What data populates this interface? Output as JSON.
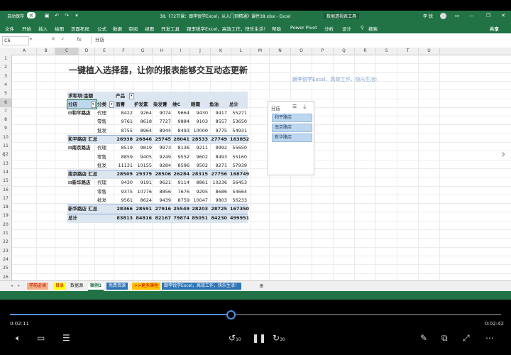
{
  "window": {
    "title": "38.《72节课：跟李锐学Excel，从入门到精通》课件38.xlsx - Excel",
    "context_tab": "数据透视表工具",
    "autosave_label": "自动保存",
    "autosave_state": "关",
    "user": "李 锐"
  },
  "ribbon": {
    "tabs": [
      "文件",
      "开始",
      "插入",
      "绘图",
      "页面布局",
      "公式",
      "数据",
      "审阅",
      "视图",
      "开发工具",
      "跟李锐学Excel，高效工作，快乐生活！",
      "帮助",
      "Power Pivot",
      "分析",
      "设计"
    ],
    "search_placeholder": "搜索",
    "share": "共享"
  },
  "formula_bar": {
    "name_box": "C6",
    "fx": "fx",
    "content": "分店"
  },
  "columns": [
    "A",
    "B",
    "C",
    "D",
    "E",
    "F",
    "G",
    "H",
    "I",
    "J",
    "K",
    "L",
    "M",
    "N",
    "O",
    "P",
    "Q",
    "R",
    "S",
    "T",
    "U"
  ],
  "rows": [
    "1",
    "2",
    "3",
    "4",
    "5",
    "6",
    "7",
    "8",
    "9",
    "10",
    "11",
    "12",
    "13",
    "14",
    "15",
    "16",
    "17",
    "18",
    "19",
    "20",
    "21",
    "22",
    "23",
    "24",
    "25",
    "26"
  ],
  "sheet": {
    "title": "一键植入选择器，让你的报表能够交互动态更新",
    "slogan": "跟李锐学Excel、高效工作、快乐生活!",
    "pivot": {
      "value_label": "求和项:金额",
      "col_field": "产品",
      "row_field1": "分店",
      "row_field2": "分类",
      "headers": [
        "面膏",
        "护发素",
        "染发膏",
        "维C",
        "眼霜",
        "鱼油",
        "总计"
      ],
      "rows": [
        {
          "store": "⊟和平路店",
          "cat": "代理",
          "vals": [
            "8422",
            "9264",
            "9074",
            "9664",
            "9430",
            "9417",
            "55271"
          ],
          "bold": false
        },
        {
          "store": "",
          "cat": "零售",
          "vals": [
            "9761",
            "8618",
            "7727",
            "9884",
            "9103",
            "8557",
            "53650"
          ],
          "bold": false
        },
        {
          "store": "",
          "cat": "批发",
          "vals": [
            "8755",
            "8964",
            "8944",
            "8493",
            "10000",
            "9775",
            "54931"
          ],
          "bold": false
        },
        {
          "store": "和平路店 汇总",
          "cat": "",
          "vals": [
            "26938",
            "26846",
            "25745",
            "28041",
            "28533",
            "27749",
            "163852"
          ],
          "bold": true
        },
        {
          "store": "⊟南京路店",
          "cat": "代理",
          "vals": [
            "8519",
            "9819",
            "9973",
            "8136",
            "9211",
            "9992",
            "55650"
          ],
          "bold": false
        },
        {
          "store": "",
          "cat": "零售",
          "vals": [
            "8859",
            "9405",
            "9249",
            "9552",
            "9602",
            "8493",
            "55160"
          ],
          "bold": false
        },
        {
          "store": "",
          "cat": "批发",
          "vals": [
            "11131",
            "10155",
            "9284",
            "8596",
            "9502",
            "9271",
            "57939"
          ],
          "bold": false
        },
        {
          "store": "南京路店 汇总",
          "cat": "",
          "vals": [
            "28509",
            "29379",
            "28506",
            "26284",
            "28315",
            "27756",
            "168749"
          ],
          "bold": true
        },
        {
          "store": "⊟新华路店",
          "cat": "代理",
          "vals": [
            "9430",
            "9191",
            "9621",
            "9114",
            "8861",
            "10236",
            "56453"
          ],
          "bold": false
        },
        {
          "store": "",
          "cat": "零售",
          "vals": [
            "9375",
            "10776",
            "8856",
            "7676",
            "9295",
            "8686",
            "54664"
          ],
          "bold": false
        },
        {
          "store": "",
          "cat": "批发",
          "vals": [
            "9561",
            "8624",
            "9439",
            "8759",
            "10047",
            "9803",
            "56233"
          ],
          "bold": false
        },
        {
          "store": "新华路店 汇总",
          "cat": "",
          "vals": [
            "28366",
            "28591",
            "27916",
            "25549",
            "28203",
            "28725",
            "167350"
          ],
          "bold": true
        },
        {
          "store": "总计",
          "cat": "",
          "vals": [
            "83813",
            "84816",
            "82167",
            "79874",
            "85051",
            "84230",
            "499951"
          ],
          "bold": true
        }
      ]
    },
    "slicer": {
      "title": "分店",
      "items": [
        "和平路店",
        "南京路店",
        "新华路店"
      ]
    }
  },
  "sheet_tabs": [
    {
      "label": "学前必读",
      "bg": "#f4b183",
      "fg": "#c00000"
    },
    {
      "label": "目录",
      "bg": "#ffff00",
      "fg": "#c00000"
    },
    {
      "label": "数据源",
      "bg": "#f0f0f0",
      "fg": "#222"
    },
    {
      "label": "案例1",
      "bg": "#ffffff",
      "fg": "#217346"
    },
    {
      "label": "免费资源",
      "bg": "#2e75b6",
      "fg": "#fff"
    },
    {
      "label": ">>更多课程",
      "bg": "#ffc000",
      "fg": "#c00000"
    },
    {
      "label": "跟李锐学Excel，高效工作，快乐生活！",
      "bg": "#2e75b6",
      "fg": "#fff"
    }
  ],
  "player": {
    "current_time": "0:02:11",
    "total_time": "0:02:42",
    "progress": 0.45,
    "rewind_label": "10",
    "forward_label": "30"
  },
  "colors": {
    "excel_green": "#217346",
    "progress_blue": "#4d8fe0"
  }
}
